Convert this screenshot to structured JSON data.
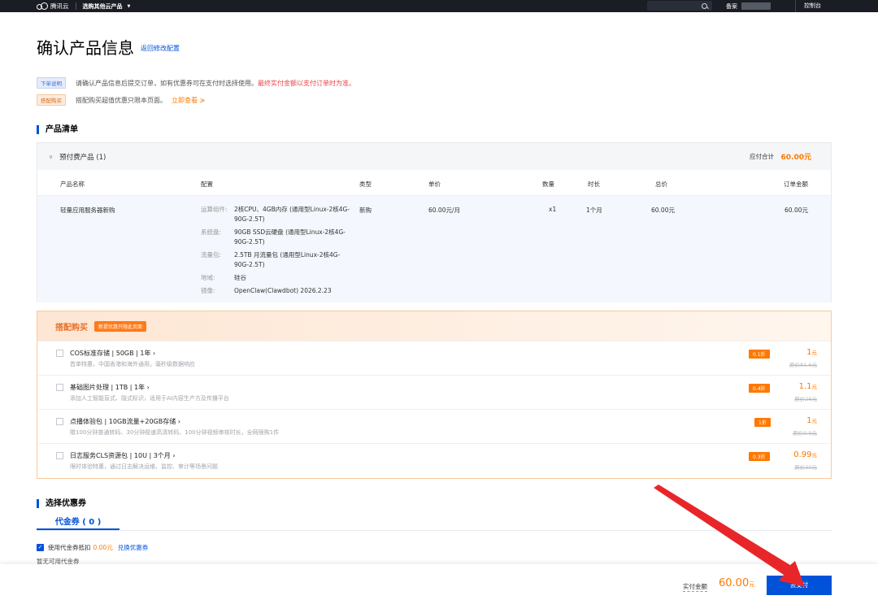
{
  "topnav": {
    "logo_text": "腾讯云",
    "product_menu": "选购其他云产品",
    "beian": "备案",
    "console": "控制台"
  },
  "header": {
    "title": "确认产品信息",
    "back_link": "返回修改配置"
  },
  "notices": {
    "order_tag": "下单说明",
    "order_text": "请确认产品信息后提交订单，如有优惠券可在支付时选择使用。",
    "order_red": "最终实付金额以支付订单时为准。",
    "bundle_tag": "搭配购买",
    "bundle_text": "搭配购买超值优惠只限本页面。",
    "bundle_link": "立即查看"
  },
  "product_list": {
    "section_title": "产品清单",
    "group_label": "预付费产品 (1)",
    "total_label": "应付合计",
    "total_value": "60.00元",
    "columns": [
      "产品名称",
      "配置",
      "类型",
      "单价",
      "数量",
      "时长",
      "总价",
      "订单金额"
    ],
    "row": {
      "name": "轻量应用服务器新购",
      "config": [
        {
          "key": "运算组件:",
          "value": "2核CPU、4GB内存 (通用型Linux-2核4G-90G-2.5T)"
        },
        {
          "key": "系统盘:",
          "value": "90GB SSD云硬盘 (通用型Linux-2核4G-90G-2.5T)"
        },
        {
          "key": "流量包:",
          "value": "2.5TB 月流量包 (通用型Linux-2核4G-90G-2.5T)"
        },
        {
          "key": "地域:",
          "value": "硅谷"
        },
        {
          "key": "镜像:",
          "value": "OpenClaw(Clawdbot) 2026.2.23"
        }
      ],
      "type": "新购",
      "unit_price": "60.00元/月",
      "quantity": "x1",
      "duration": "1个月",
      "total": "60.00元",
      "order_amount": "60.00元"
    }
  },
  "bundle": {
    "title": "搭配购买",
    "pill": "新提优惠只限此页面",
    "items": [
      {
        "name": "COS标准存储 | 50GB | 1年",
        "desc": "首单特惠，中国香港和海外通用，毫秒级数据响应",
        "discount": "0.1折",
        "price": "1",
        "unit": "元",
        "original": "原价81.6元"
      },
      {
        "name": "基础图片处理 | 1TB | 1年",
        "desc": "添加人工智能盲式、隐式标识，适用于AI内容生产方及传播平台",
        "discount": "0.4折",
        "price": "1.1",
        "unit": "元",
        "original": "原价26元"
      },
      {
        "name": "点播体验包 | 10GB流量+20GB存储",
        "desc": "赠100分钟普通转码、30分钟极速高清转码、100分钟视频审核时长，全网限购1件",
        "discount": "1折",
        "price": "1",
        "unit": "元",
        "original": "原价9.9元"
      },
      {
        "name": "日志服务CLS资源包 | 10U | 3个月",
        "desc": "限时体验特惠，通过日志解决运维、监控、审计等场景问题",
        "discount": "0.3折",
        "price": "0.99",
        "unit": "元",
        "original": "原价30元"
      }
    ]
  },
  "coupon": {
    "section_title": "选择优惠券",
    "tab": "代金券 ( 0 )",
    "use_label": "使用代金券抵扣",
    "use_amount": "0.00元",
    "redeem_link": "兑换优惠券",
    "empty_text": "暂无可用代金券"
  },
  "footer": {
    "pay_label": "实付金额",
    "pay_amount": "60.00",
    "pay_unit": "元",
    "pay_button": "去支付"
  },
  "colors": {
    "brand_blue": "#0052d9",
    "accent_orange": "#ff7800",
    "annotation_red": "#e8262a",
    "nav_bg": "#1a1d24"
  }
}
